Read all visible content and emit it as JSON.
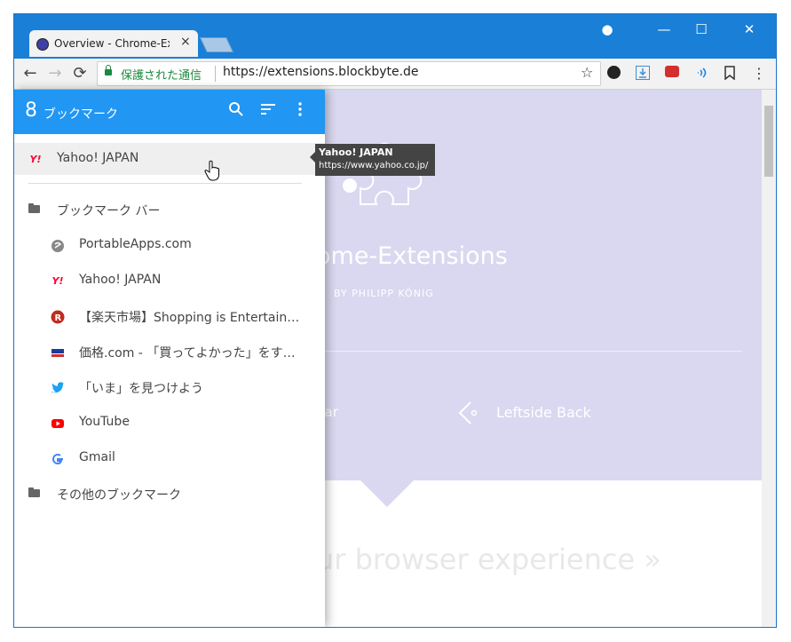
{
  "browser": {
    "tab_title": "Overview - Chrome-Ex",
    "tab_close": "×",
    "window_controls": {
      "account": "●",
      "minimize": "—",
      "maximize": "☐",
      "close": "✕"
    },
    "nav": {
      "back": "←",
      "forward": "→",
      "reload": "⟳"
    },
    "omnibox": {
      "secure_label": "保護された通信",
      "url": "https://extensions.blockbyte.de",
      "star": "☆"
    },
    "extensions": {
      "menu": "⋮"
    }
  },
  "page": {
    "hero_title": "ome-Extensions",
    "byline": "BY PHILIPP KÖNIG",
    "bar_label": "bar",
    "leftside_label": "Leftside Back",
    "tagline": "ur browser experience  »"
  },
  "panel": {
    "count": "8",
    "title": "ブックマーク",
    "icons": {
      "search": "search-icon",
      "sort": "sort-icon",
      "menu": "more-vert-icon"
    },
    "pinned": {
      "label": "Yahoo! JAPAN"
    },
    "bookmarks_bar": {
      "label": "ブックマーク バー"
    },
    "items": [
      {
        "label": "PortableApps.com",
        "icon": "portableapps-icon",
        "color": "#888888"
      },
      {
        "label": "Yahoo! JAPAN",
        "icon": "yahoo-icon",
        "color": "#ff0033"
      },
      {
        "label": "【楽天市場】Shopping is Entertain…",
        "icon": "rakuten-icon",
        "color": "#bf2c20"
      },
      {
        "label": "価格.com - 「買ってよかった」をす…",
        "icon": "kakaku-icon",
        "color": "#1a3c9c"
      },
      {
        "label": "「いま」を見つけよう",
        "icon": "twitter-icon",
        "color": "#1da1f2"
      },
      {
        "label": "YouTube",
        "icon": "youtube-icon",
        "color": "#ff0000"
      },
      {
        "label": "Gmail",
        "icon": "google-icon",
        "color": "#4285f4"
      }
    ],
    "other_folder": {
      "label": "その他のブックマーク"
    }
  },
  "tooltip": {
    "title": "Yahoo! JAPAN",
    "url": "https://www.yahoo.co.jp/"
  }
}
